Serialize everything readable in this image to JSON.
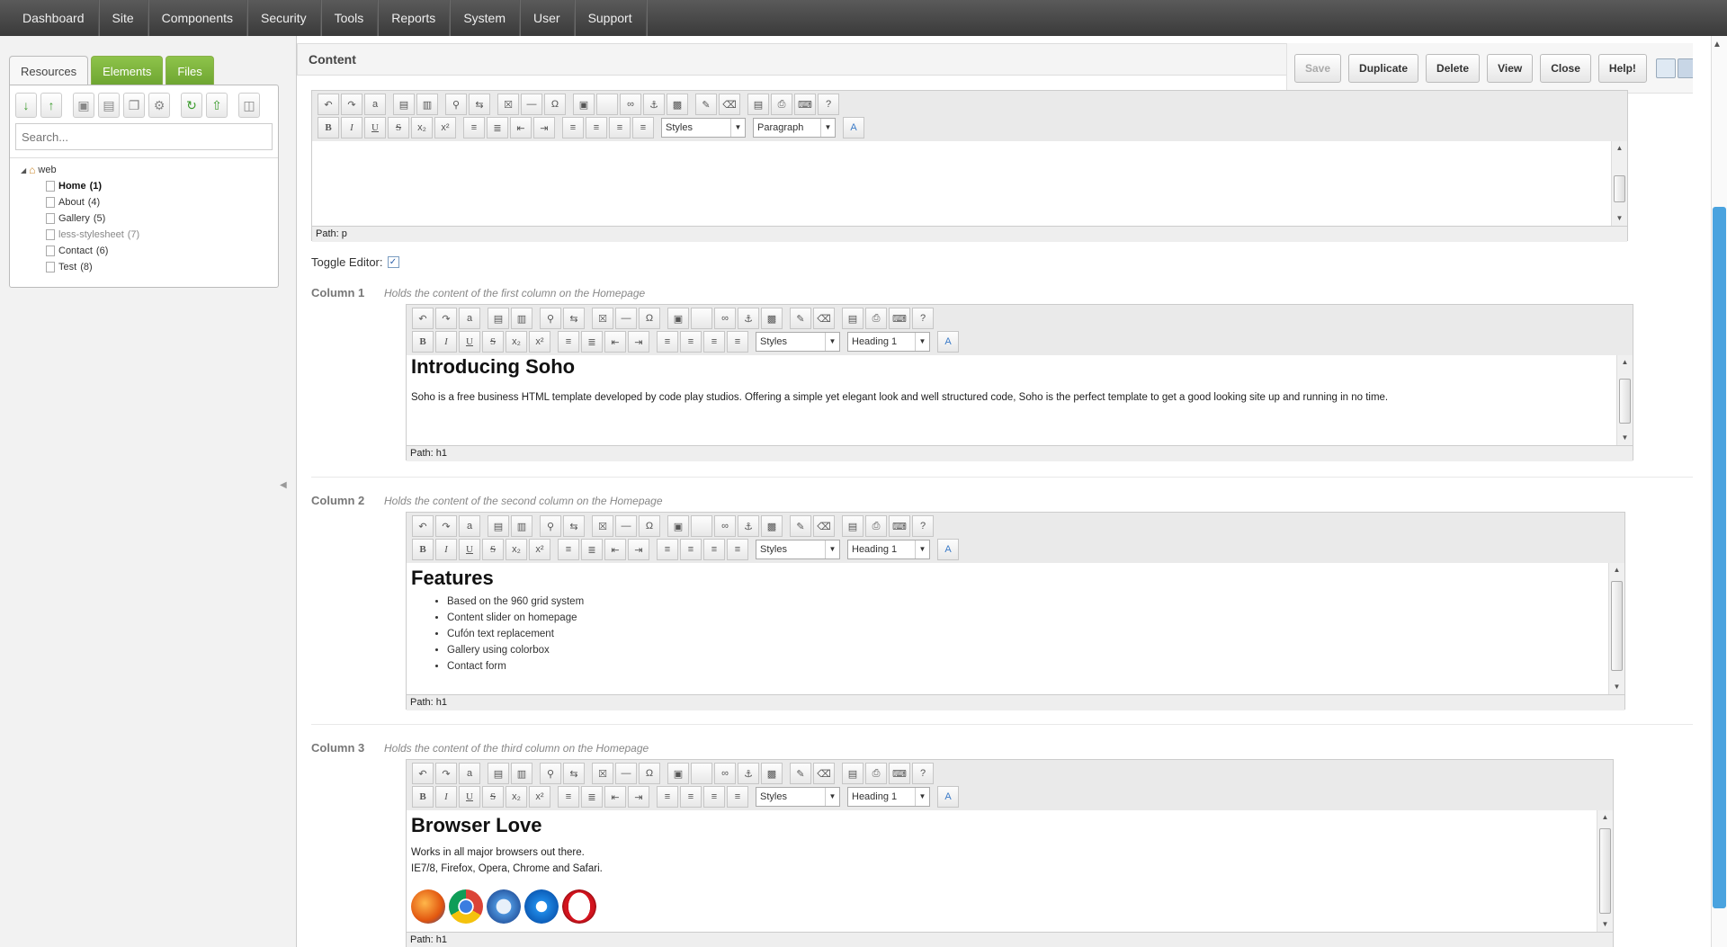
{
  "nav": [
    "Dashboard",
    "Site",
    "Components",
    "Security",
    "Tools",
    "Reports",
    "System",
    "User",
    "Support"
  ],
  "left": {
    "tabs": [
      "Resources",
      "Elements",
      "Files"
    ],
    "search_placeholder": "Search...",
    "tree_root": "web",
    "tree_items": [
      {
        "label": "Home",
        "count": "(1)"
      },
      {
        "label": "About",
        "count": "(4)"
      },
      {
        "label": "Gallery",
        "count": "(5)"
      },
      {
        "label": "less-stylesheet",
        "count": "(7)"
      },
      {
        "label": "Contact",
        "count": "(6)"
      },
      {
        "label": "Test",
        "count": "(8)"
      }
    ]
  },
  "content": {
    "title": "Content",
    "actions": [
      "Save",
      "Duplicate",
      "Delete",
      "View",
      "Close",
      "Help!"
    ],
    "toggle_editor": "Toggle Editor:",
    "styles_label": "Styles",
    "main_editor": {
      "format": "Paragraph",
      "path": "Path: p"
    },
    "columns": [
      {
        "label": "Column 1",
        "help": "Holds the content of the first column on the Homepage",
        "format": "Heading 1",
        "heading": "Introducing Soho",
        "body": "Soho is a free business HTML template developed by code play studios. Offering a simple yet elegant look and well structured code, Soho is the perfect template to get a good looking site up and running in no time.",
        "path": "Path: h1"
      },
      {
        "label": "Column 2",
        "help": "Holds the content of the second column on the Homepage",
        "format": "Heading 1",
        "heading": "Features",
        "list": [
          "Based on the 960 grid system",
          "Content slider on homepage",
          "Cufón text replacement",
          "Gallery using colorbox",
          "Contact form"
        ],
        "path": "Path: h1"
      },
      {
        "label": "Column 3",
        "help": "Holds the content of the third column on the Homepage",
        "format": "Heading 1",
        "heading": "Browser Love",
        "line1": "Works in all major browsers out there.",
        "line2": "IE7/8, Firefox, Opera, Chrome and Safari.",
        "path": "Path: h1"
      }
    ]
  },
  "colors": {
    "nav_bg": "#4a4a4a",
    "tab_green": "#7db53c",
    "scroll_accent": "#4aa3df"
  }
}
